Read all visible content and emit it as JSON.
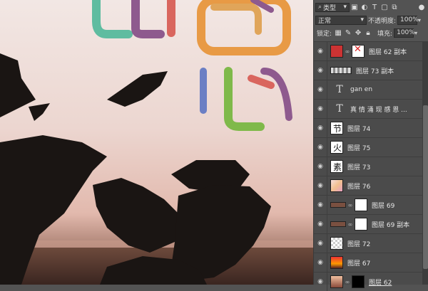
{
  "panel": {
    "filter_kind": "类型",
    "blend_mode": "正常",
    "opacity_label": "不透明度:",
    "opacity_value": "100%",
    "lock_label": "锁定:",
    "fill_label": "填充:",
    "fill_value": "100%",
    "filter_icons": [
      "image-filter-icon",
      "adjustment-filter-icon",
      "type-filter-icon",
      "shape-filter-icon",
      "smart-object-filter-icon"
    ],
    "lock_icons": [
      "lock-transparent-icon",
      "lock-pixels-icon",
      "lock-position-icon",
      "lock-all-icon"
    ]
  },
  "layers": [
    {
      "name": "图层 62 副本",
      "type": "mask"
    },
    {
      "name": "图层 73 副本",
      "type": "pixel"
    },
    {
      "name": "gan en",
      "type": "text"
    },
    {
      "name": "真 情 涌 现 感 恩 ...",
      "type": "text"
    },
    {
      "name": "图层 74",
      "type": "pixel"
    },
    {
      "name": "图层 75",
      "type": "pixel"
    },
    {
      "name": "图层 73",
      "type": "pixel"
    },
    {
      "name": "图层 76",
      "type": "pixel"
    },
    {
      "name": "图层 69",
      "type": "mask"
    },
    {
      "name": "图层 69 副本",
      "type": "mask"
    },
    {
      "name": "图层 72",
      "type": "pixel"
    },
    {
      "name": "图层 67",
      "type": "pixel"
    },
    {
      "name": "图层 62",
      "type": "mask"
    }
  ],
  "colors": {
    "purple": "#8e5a8e",
    "green": "#7fb94a",
    "orange": "#e89a45",
    "blue": "#6b7fc4",
    "teal": "#5fbca0",
    "red": "#d9665e",
    "ink": "#1a1513"
  }
}
